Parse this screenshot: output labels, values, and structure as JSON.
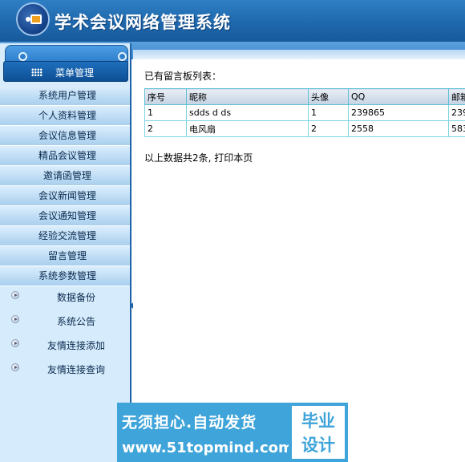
{
  "header": {
    "title": "学术会议网络管理系统"
  },
  "sidebar": {
    "menu_header": "菜单管理",
    "items": [
      {
        "label": "系统用户管理"
      },
      {
        "label": "个人资料管理"
      },
      {
        "label": "会议信息管理"
      },
      {
        "label": "精品会议管理"
      },
      {
        "label": "邀请函管理"
      },
      {
        "label": "会议新闻管理"
      },
      {
        "label": "会议通知管理"
      },
      {
        "label": "经验交流管理"
      },
      {
        "label": "留言管理"
      },
      {
        "label": "系统参数管理"
      }
    ],
    "subitems": [
      {
        "label": "数据备份"
      },
      {
        "label": "系统公告"
      },
      {
        "label": "友情连接添加"
      },
      {
        "label": "友情连接查询"
      }
    ]
  },
  "main": {
    "section_title": "已有留言板列表：",
    "table": {
      "headers": [
        "序号",
        "昵称",
        "头像",
        "QQ",
        "邮箱"
      ],
      "rows": [
        [
          "1",
          "sdds d ds",
          "1",
          "239865",
          "239"
        ],
        [
          "2",
          "电风扇",
          "2",
          "2558",
          "583"
        ]
      ]
    },
    "footer_text": "以上数据共2条, 打印本页"
  },
  "watermark": {
    "line1": "无须担心.自动发货",
    "line2": "www.51topmind.com",
    "badge_line1": "毕业",
    "badge_line2": "设计"
  }
}
